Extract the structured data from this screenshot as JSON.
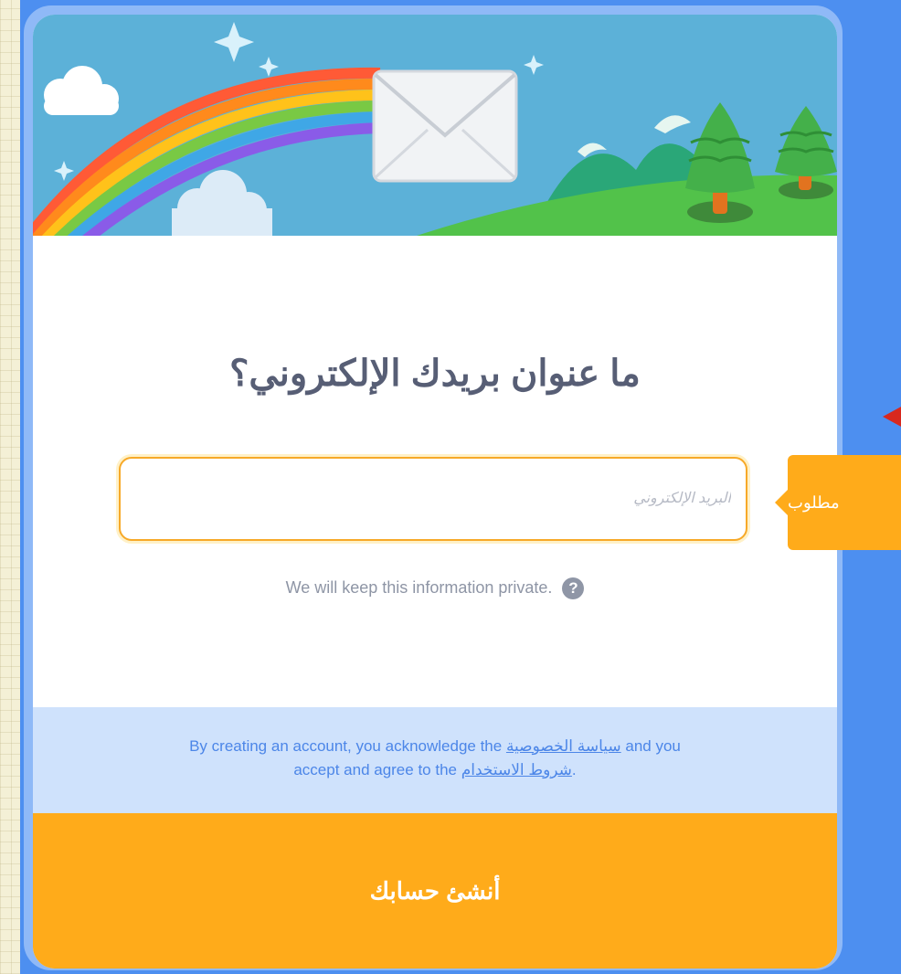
{
  "signup": {
    "title": "ما عنوان بريدك الإلكتروني؟",
    "email_placeholder": "البريد الإلكتروني",
    "email_value": "",
    "privacy_note": "We will keep this information private.",
    "help_glyph": "?",
    "legal": {
      "part1": "By creating an account, you acknowledge the ",
      "privacy_link": "سياسة الخصوصية",
      "part2": " and you",
      "part3": "accept and agree to the ",
      "terms_link": "شروط الاستخدام",
      "part4": "."
    },
    "create_button": "أنشئ حسابك",
    "required_tooltip": "مطلوب"
  },
  "colors": {
    "page_bg": "#4d8ff0",
    "accent_orange": "#ffab1a",
    "title_text": "#575e75",
    "legal_bg": "#cfe2fc",
    "link_blue": "#4c86e8",
    "error_arrow": "#d8281e"
  },
  "icons": {
    "banner": "envelope-rainbow-illustration",
    "help": "question-circle-icon",
    "tooltip_pointer": "triangle-pointer"
  }
}
